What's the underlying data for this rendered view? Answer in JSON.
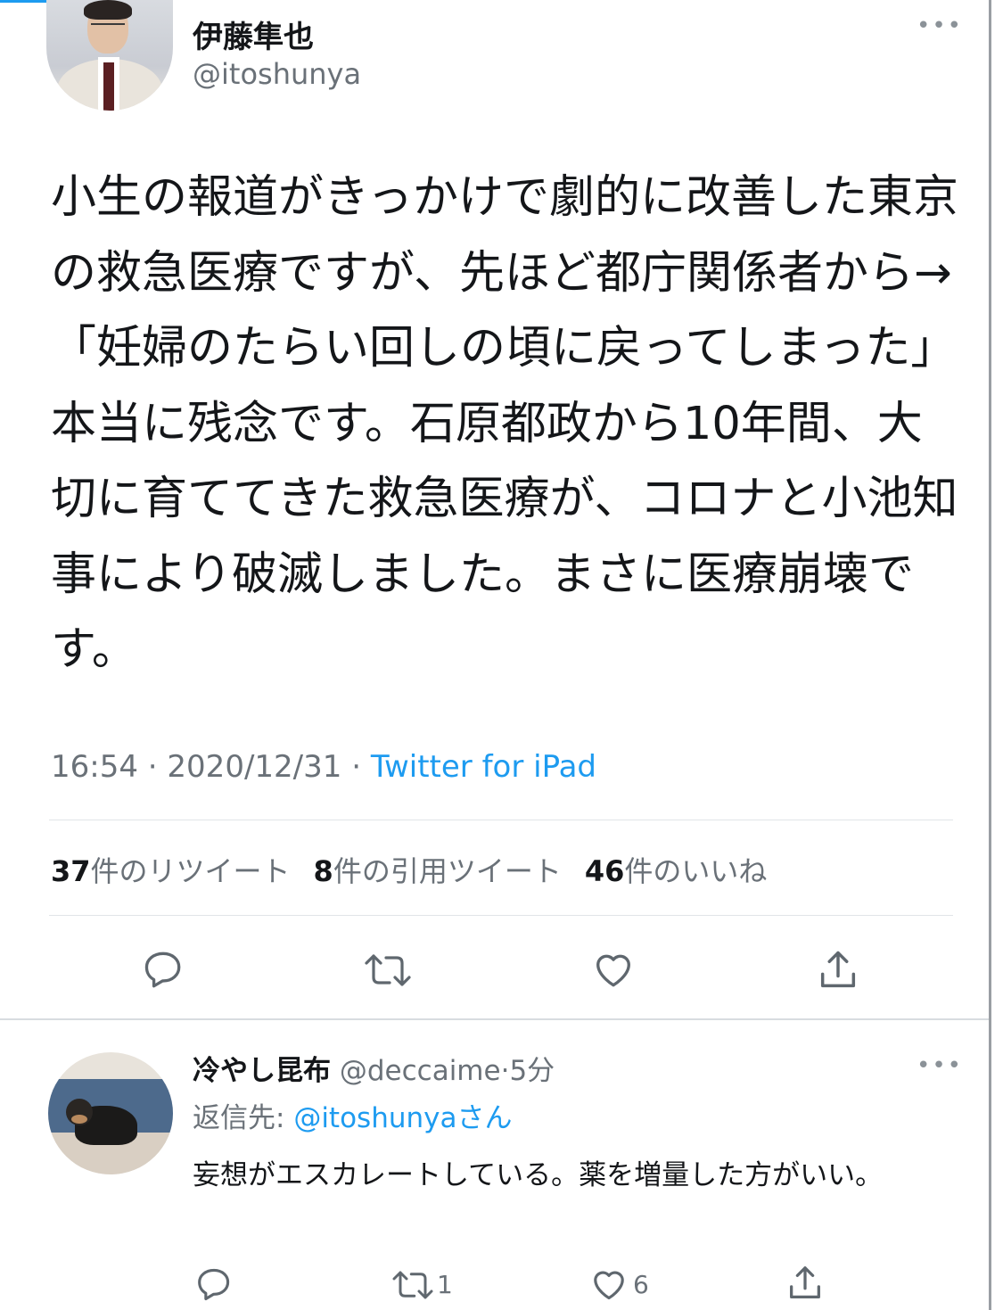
{
  "tweet": {
    "display_name": "伊藤隼也",
    "handle": "@itoshunya",
    "more_icon": "•••",
    "text": "小生の報道がきっかけで劇的に改善した東京の救急医療ですが、先ほど都庁関係者から→「妊婦のたらい回しの頃に戻ってしまった」本当に残念です。石原都政から10年間、大切に育ててきた救急医療が、コロナと小池知事により破滅しました。まさに医療崩壊です。",
    "time": "16:54",
    "date": "2020/12/31",
    "separator": "·",
    "source": "Twitter for iPad",
    "stats": {
      "retweets_num": "37",
      "retweets_label": "件のリツイート",
      "quotes_num": "8",
      "quotes_label": "件の引用ツイート",
      "likes_num": "46",
      "likes_label": "件のいいね"
    },
    "actions": [
      "reply-icon",
      "retweet-icon",
      "like-icon",
      "share-icon"
    ]
  },
  "reply": {
    "display_name": "冷やし昆布",
    "handle": "@deccaime",
    "separator": "·",
    "time_ago": "5分",
    "more_icon": "•••",
    "reply_to_label": "返信先:",
    "reply_to_handle": "@itoshunya",
    "reply_to_suffix": "さん",
    "text": "妄想がエスカレートしている。薬を増量した方がいい。",
    "retweet_count": "1",
    "like_count": "6"
  },
  "colors": {
    "accent": "#1d9bf0",
    "text": "#141619",
    "secondary": "#6a7178",
    "divider": "#e1e5e8"
  }
}
